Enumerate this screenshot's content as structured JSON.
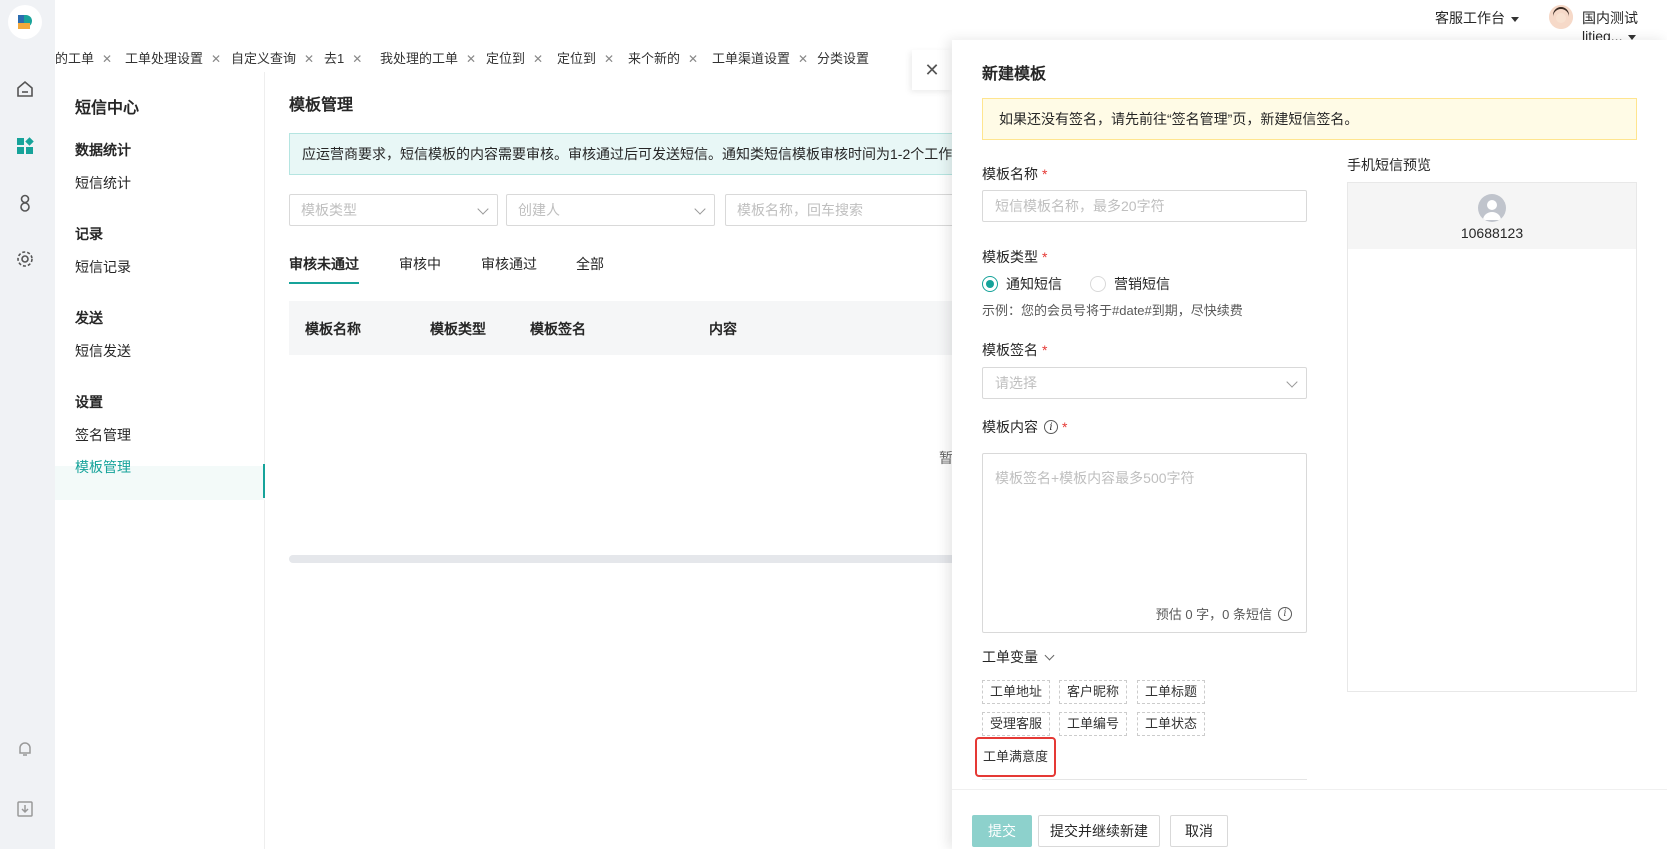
{
  "header": {
    "workspace_label": "客服工作台",
    "user_name": "国内测试litieg..."
  },
  "tabs": [
    {
      "label": "的工单"
    },
    {
      "label": "工单处理设置"
    },
    {
      "label": "自定义查询"
    },
    {
      "label": "去1"
    },
    {
      "label": "我处理的工单"
    },
    {
      "label": "定位到"
    },
    {
      "label": "定位到"
    },
    {
      "label": "来个新的"
    },
    {
      "label": "工单渠道设置"
    },
    {
      "label": "分类设置"
    }
  ],
  "sms_nav": {
    "title": "短信中心",
    "groups": [
      {
        "title": "数据统计",
        "items": [
          "短信统计"
        ]
      },
      {
        "title": "记录",
        "items": [
          "短信记录"
        ]
      },
      {
        "title": "发送",
        "items": [
          "短信发送"
        ]
      },
      {
        "title": "设置",
        "items": [
          "签名管理",
          "模板管理"
        ]
      }
    ]
  },
  "main": {
    "title": "模板管理",
    "notice": "应运营商要求，短信模板的内容需要审核。审核通过后可发送短信。通知类短信模板审核时间为1-2个工作",
    "filters": {
      "type_placeholder": "模板类型",
      "creator_placeholder": "创建人",
      "search_placeholder": "模板名称，回车搜索"
    },
    "status_tabs": [
      "审核未通过",
      "审核中",
      "审核通过",
      "全部"
    ],
    "columns": [
      "模板名称",
      "模板类型",
      "模板签名",
      "内容"
    ],
    "empty_text": "暂"
  },
  "drawer": {
    "title": "新建模板",
    "warning": "如果还没有签名，请先前往“签名管理”页，新建短信签名。",
    "name_label": "模板名称",
    "name_placeholder": "短信模板名称，最多20字符",
    "type_label": "模板类型",
    "type_options": [
      "通知短信",
      "营销短信"
    ],
    "type_selected": "通知短信",
    "example": "示例：您的会员号将于#date#到期，尽快续费",
    "sign_label": "模板签名",
    "sign_placeholder": "请选择",
    "content_label": "模板内容",
    "content_placeholder": "模板签名+模板内容最多500字符",
    "counter": "预估 0 字，0 条短信",
    "vars_title": "工单变量",
    "variables": [
      "工单地址",
      "客户昵称",
      "工单标题",
      "受理客服",
      "工单编号",
      "工单状态",
      "工单满意度"
    ],
    "preview_label": "手机短信预览",
    "preview_number": "10688123",
    "buttons": {
      "submit": "提交",
      "submit_continue": "提交并继续新建",
      "cancel": "取消"
    },
    "required_mark": "*"
  },
  "colors": {
    "accent": "#16a39a",
    "highlight_border": "#e53935"
  }
}
